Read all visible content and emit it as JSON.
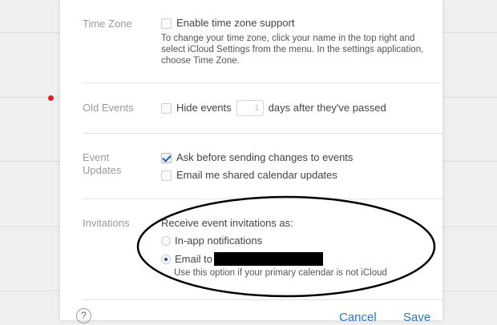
{
  "timezone": {
    "label": "Time Zone",
    "checkbox_label": "Enable time zone support",
    "checked": false,
    "description": "To change your time zone, click your name in the top right and select iCloud Settings from the menu. In the settings application, choose Time Zone."
  },
  "old_events": {
    "label": "Old Events",
    "checkbox_label": "Hide events",
    "checked": false,
    "days_value": "1",
    "suffix": "days after they've passed"
  },
  "event_updates": {
    "label": "Event Updates",
    "options": [
      {
        "label": "Ask before sending changes to events",
        "checked": true
      },
      {
        "label": "Email me shared calendar updates",
        "checked": false
      }
    ]
  },
  "invitations": {
    "label": "Invitations",
    "prompt": "Receive event invitations as:",
    "option_inapp": "In-app notifications",
    "option_email": "Email to",
    "selected": "email",
    "note": "Use this option if your primary calendar is not iCloud"
  },
  "footer": {
    "help": "?",
    "cancel": "Cancel",
    "save": "Save"
  }
}
